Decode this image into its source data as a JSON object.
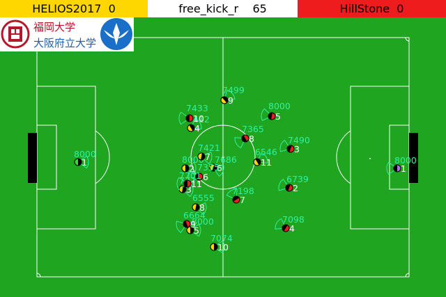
{
  "scoreboard": {
    "left_team": "HELIOS2017",
    "left_score": "0",
    "play_mode": "free_kick_r",
    "cycle": "65",
    "right_team": "HillStone",
    "right_score": "0"
  },
  "logo": {
    "university_name_top": "福岡大学",
    "university_name_bottom": "大阪府立大学"
  },
  "colors": {
    "field": "#1fa51f",
    "left_team": "#ffd700",
    "right_team": "#ee1c1c",
    "label": "#2ef0a0"
  },
  "players": [
    {
      "id": "left-1",
      "team": "left",
      "number": "1",
      "stamina": "8000",
      "goalie": true
    },
    {
      "id": "left-2",
      "team": "left",
      "number": "2",
      "stamina": "8000"
    },
    {
      "id": "left-3",
      "team": "left",
      "number": "3",
      "stamina": "7777"
    },
    {
      "id": "left-4",
      "team": "left",
      "number": "4",
      "stamina": "7412"
    },
    {
      "id": "left-5",
      "team": "left",
      "number": "5",
      "stamina": "8000"
    },
    {
      "id": "left-6",
      "team": "left",
      "number": "6",
      "stamina": "7686"
    },
    {
      "id": "left-7",
      "team": "left",
      "number": "7",
      "stamina": "7421"
    },
    {
      "id": "left-8",
      "team": "left",
      "number": "8",
      "stamina": "6555"
    },
    {
      "id": "left-9",
      "team": "left",
      "number": "9",
      "stamina": "7499"
    },
    {
      "id": "left-10",
      "team": "left",
      "number": "10",
      "stamina": "7074"
    },
    {
      "id": "left-11",
      "team": "left",
      "number": "11",
      "stamina": "6546"
    },
    {
      "id": "right-1",
      "team": "right",
      "number": "1",
      "stamina": "8000",
      "goalie": true
    },
    {
      "id": "right-2",
      "team": "right",
      "number": "2",
      "stamina": "6739"
    },
    {
      "id": "right-3",
      "team": "right",
      "number": "3",
      "stamina": "7490"
    },
    {
      "id": "right-4",
      "team": "right",
      "number": "4",
      "stamina": "7098"
    },
    {
      "id": "right-5",
      "team": "right",
      "number": "5",
      "stamina": "8000"
    },
    {
      "id": "right-6",
      "team": "right",
      "number": "6",
      "stamina": "7355"
    },
    {
      "id": "right-7",
      "team": "right",
      "number": "7",
      "stamina": "7198"
    },
    {
      "id": "right-8",
      "team": "right",
      "number": "8",
      "stamina": "7365"
    },
    {
      "id": "right-9",
      "team": "right",
      "number": "9",
      "stamina": "6664"
    },
    {
      "id": "right-10",
      "team": "right",
      "number": "10",
      "stamina": "7433"
    },
    {
      "id": "right-11",
      "team": "right",
      "number": "11",
      "stamina": "7701"
    }
  ]
}
